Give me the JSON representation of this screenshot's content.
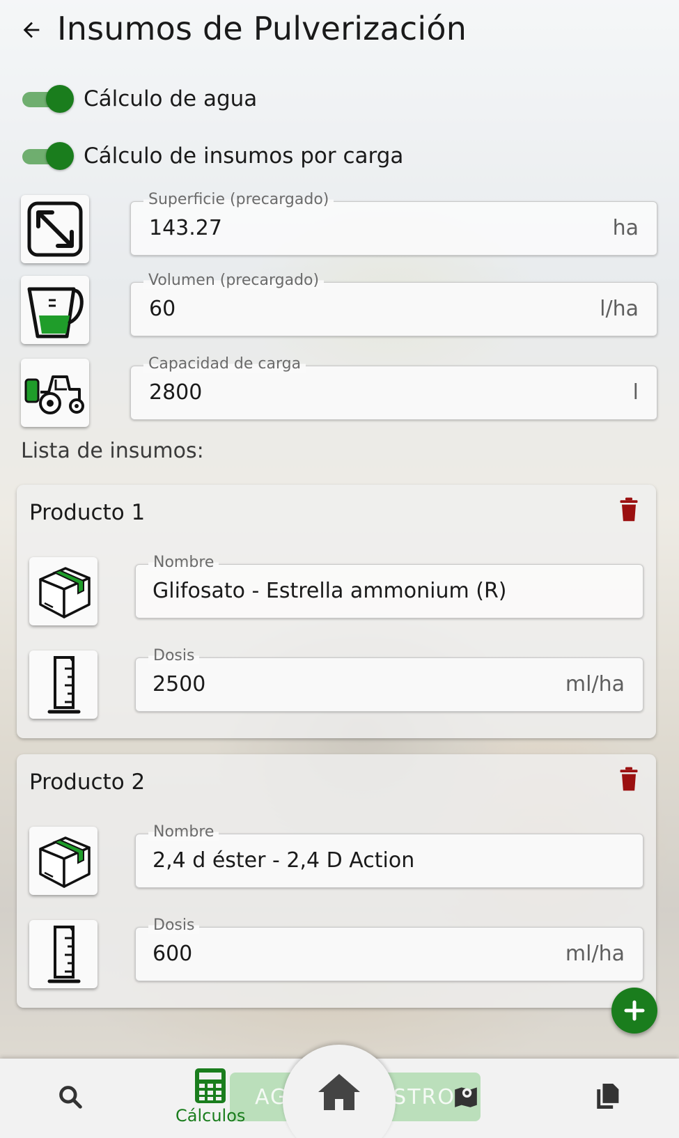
{
  "header": {
    "title": "Insumos de Pulverización"
  },
  "toggles": [
    {
      "label": "Cálculo de agua",
      "on": true
    },
    {
      "label": "Cálculo de insumos por carga",
      "on": true
    }
  ],
  "fields": {
    "superficie": {
      "label": "Superficie (precargado)",
      "value": "143.27",
      "unit": "ha"
    },
    "volumen": {
      "label": "Volumen (precargado)",
      "value": "60",
      "unit": "l/ha"
    },
    "capacidad": {
      "label": "Capacidad de carga",
      "value": "2800",
      "unit": "l"
    }
  },
  "list_title": "Lista de insumos:",
  "products": [
    {
      "title": "Producto 1",
      "name_label": "Nombre",
      "name_value": "Glifosato - Estrella ammonium (R)",
      "dose_label": "Dosis",
      "dose_value": "2500",
      "dose_unit": "ml/ha"
    },
    {
      "title": "Producto 2",
      "name_label": "Nombre",
      "name_value": "2,4 d éster - 2,4 D Action",
      "dose_label": "Dosis",
      "dose_value": "600",
      "dose_unit": "ml/ha"
    }
  ],
  "bottom_nav": {
    "calc_label": "Cálculos",
    "ghost_left": "AGREG",
    "ghost_right": "ISTRO"
  },
  "colors": {
    "accent": "#1a7d1d",
    "delete": "#9b1010"
  }
}
